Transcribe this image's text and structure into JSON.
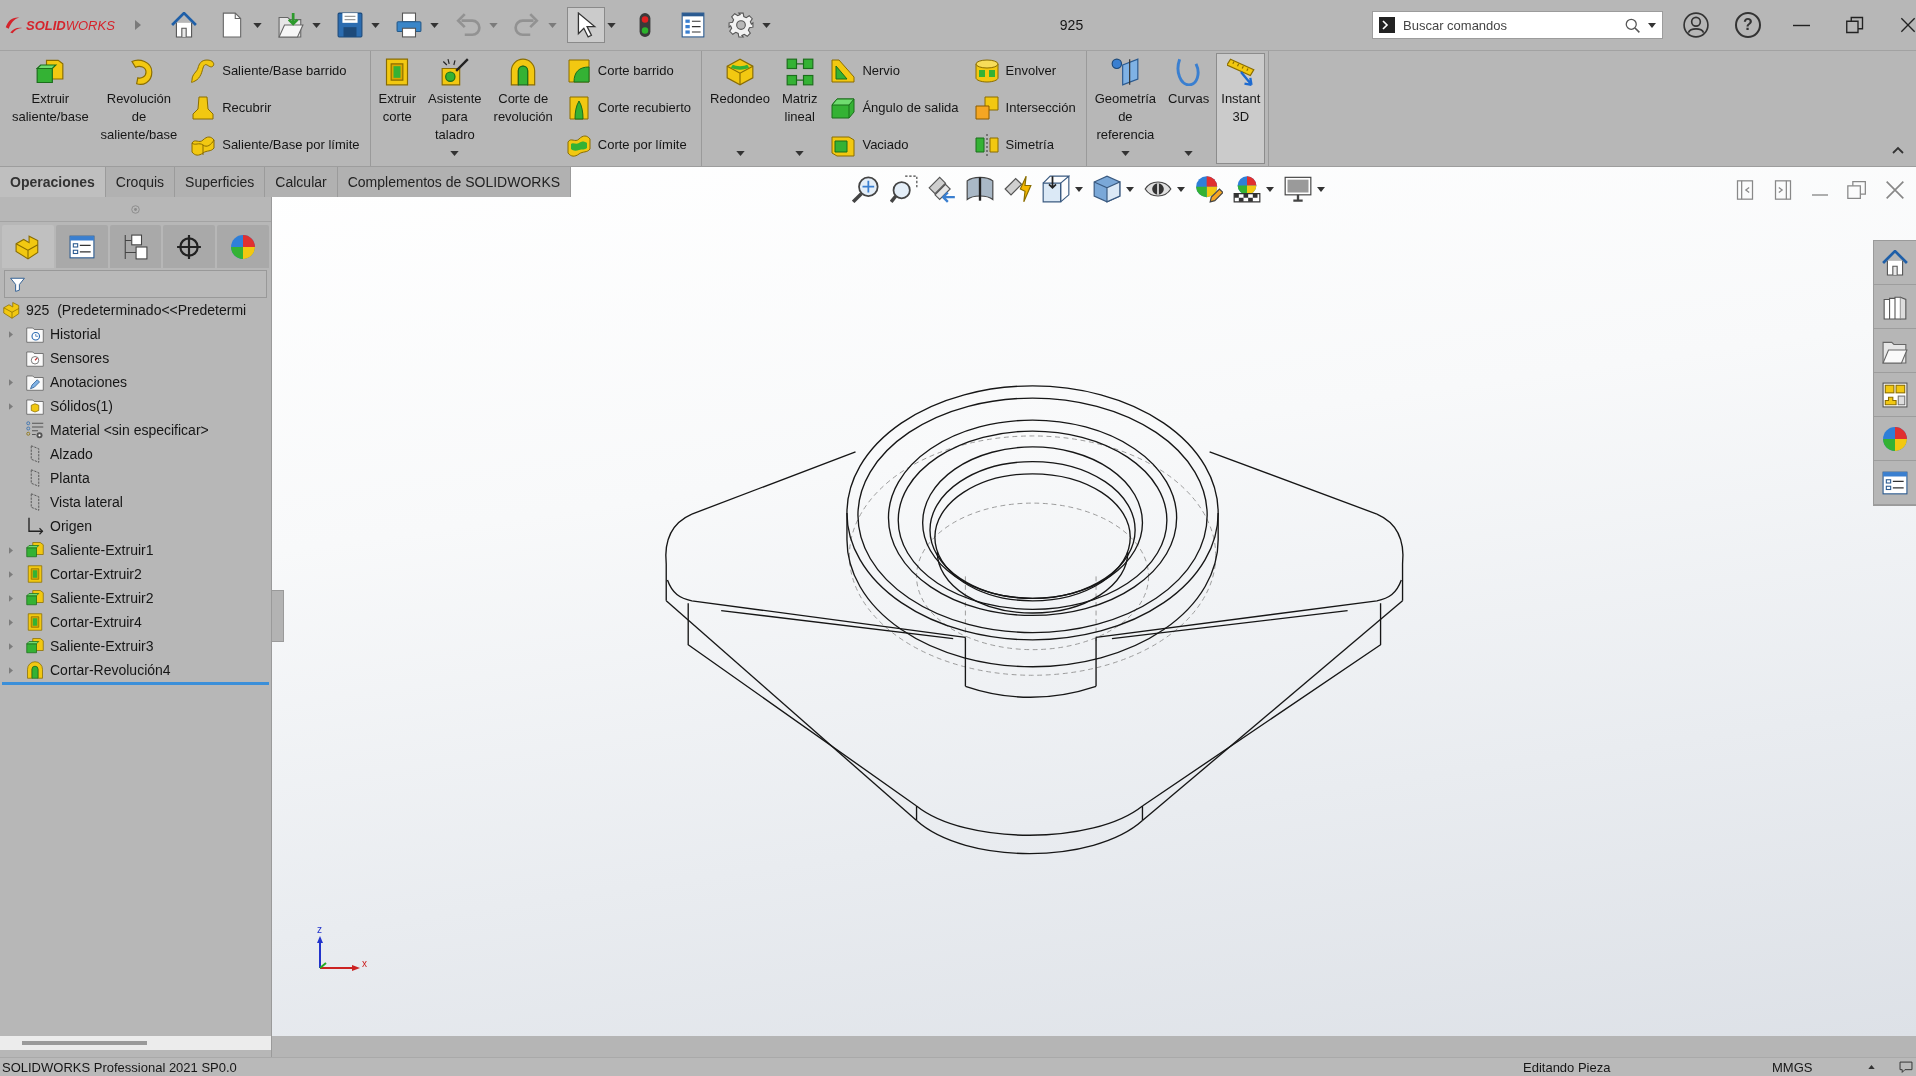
{
  "title_bar": {
    "logo": "**SOLID**WORKS",
    "quick_access": [
      {
        "menu": false,
        "disabled": false,
        "pressed": false
      },
      {
        "menu": true,
        "disabled": false,
        "pressed": false
      },
      {
        "menu": true,
        "disabled": false,
        "pressed": false
      },
      {
        "menu": true,
        "disabled": false,
        "pressed": false
      },
      {
        "menu": true,
        "disabled": false,
        "pressed": false
      },
      {
        "menu": true,
        "disabled": true,
        "pressed": false
      },
      {
        "menu": true,
        "disabled": true,
        "pressed": false
      },
      {
        "menu": true,
        "disabled": false,
        "pressed": true
      },
      {
        "menu": false,
        "disabled": false,
        "pressed": false
      },
      {
        "menu": false,
        "disabled": false,
        "pressed": false
      },
      {
        "menu": true,
        "disabled": false,
        "pressed": false
      }
    ],
    "title": "925",
    "search": {
      "placeholder": "Buscar comandos"
    },
    "help": "?"
  },
  "ribbon": {
    "groups": [
      {
        "items": [
          {
            "kind": "large",
            "label": "Extruir saliente/base",
            "menu": false,
            "pressed": false
          },
          {
            "kind": "large",
            "label": "Revolución de saliente/base",
            "menu": false,
            "pressed": false
          },
          {
            "kind": "stack",
            "entries": [
              "Saliente/Base barrido",
              "Recubrir",
              "Saliente/Base por límite"
            ]
          }
        ]
      },
      {
        "items": [
          {
            "kind": "large",
            "label": "Extruir corte",
            "menu": false,
            "pressed": false
          },
          {
            "kind": "large",
            "label": "Asistente para taladro",
            "menu": true,
            "pressed": false
          },
          {
            "kind": "large",
            "label": "Corte de revolución",
            "menu": false,
            "pressed": false
          },
          {
            "kind": "stack",
            "entries": [
              "Corte barrido",
              "Corte recubierto",
              "Corte por límite"
            ]
          }
        ]
      },
      {
        "items": [
          {
            "kind": "large",
            "label": "Redondeo",
            "menu": true,
            "pressed": false
          },
          {
            "kind": "large",
            "label": "Matriz lineal",
            "menu": true,
            "pressed": false
          },
          {
            "kind": "stack",
            "entries": [
              "Nervio",
              "Ángulo de salida",
              "Vaciado"
            ]
          },
          {
            "kind": "stack",
            "entries": [
              "Envolver",
              "Intersección",
              "Simetría"
            ]
          }
        ]
      },
      {
        "items": [
          {
            "kind": "large",
            "label": "Geometría de referencia",
            "menu": true,
            "pressed": false
          },
          {
            "kind": "large",
            "label": "Curvas",
            "menu": true,
            "pressed": false
          },
          {
            "kind": "large",
            "label": "Instant 3D",
            "menu": false,
            "pressed": true
          }
        ]
      }
    ]
  },
  "command_tabs": [
    {
      "label": "Operaciones",
      "selected": true
    },
    {
      "label": "Croquis",
      "selected": false
    },
    {
      "label": "Superficies",
      "selected": false
    },
    {
      "label": "Calcular",
      "selected": false
    },
    {
      "label": "Complementos de SOLIDWORKS",
      "selected": false
    }
  ],
  "feature_manager": {
    "panel_tabs": [
      {
        "selected": true
      },
      {
        "selected": false
      },
      {
        "selected": false
      },
      {
        "selected": false
      },
      {
        "selected": false
      }
    ],
    "tree": {
      "label": "925  (Predeterminado<<Predetermi",
      "children": [
        {
          "label": "Historial",
          "kind": "history",
          "expandable": true
        },
        {
          "label": "Sensores",
          "kind": "sensors",
          "expandable": false
        },
        {
          "label": "Anotaciones",
          "kind": "annotations",
          "expandable": true
        },
        {
          "label": "Sólidos(1)",
          "kind": "bodies",
          "expandable": true
        },
        {
          "label": "Material <sin especificar>",
          "kind": "material",
          "expandable": false
        },
        {
          "label": "Alzado",
          "kind": "plane",
          "expandable": false
        },
        {
          "label": "Planta",
          "kind": "plane",
          "expandable": false
        },
        {
          "label": "Vista lateral",
          "kind": "plane",
          "expandable": false
        },
        {
          "label": "Origen",
          "kind": "origin",
          "expandable": false
        },
        {
          "label": "Saliente-Extruir1",
          "kind": "boss",
          "expandable": true
        },
        {
          "label": "Cortar-Extruir2",
          "kind": "cut",
          "expandable": true
        },
        {
          "label": "Saliente-Extruir2",
          "kind": "boss",
          "expandable": true
        },
        {
          "label": "Cortar-Extruir4",
          "kind": "cut",
          "expandable": true
        },
        {
          "label": "Saliente-Extruir3",
          "kind": "boss",
          "expandable": true
        },
        {
          "label": "Cortar-Revolución4",
          "kind": "revolve",
          "expandable": true
        }
      ]
    }
  },
  "view_toolbar": [
    {
      "menu": false
    },
    {
      "menu": false
    },
    {
      "menu": false
    },
    {
      "menu": false
    },
    {
      "menu": false
    },
    {
      "menu": true
    },
    {
      "menu": true
    },
    {
      "menu": true
    },
    {
      "menu": false
    },
    {
      "menu": true
    },
    {
      "menu": true
    }
  ],
  "viewport": {
    "triad_labels": [
      "z",
      "x"
    ]
  },
  "status_bar": {
    "product": "SOLIDWORKS Professional 2021 SP0.0",
    "mode": "Editando Pieza",
    "units": "MMGS"
  }
}
